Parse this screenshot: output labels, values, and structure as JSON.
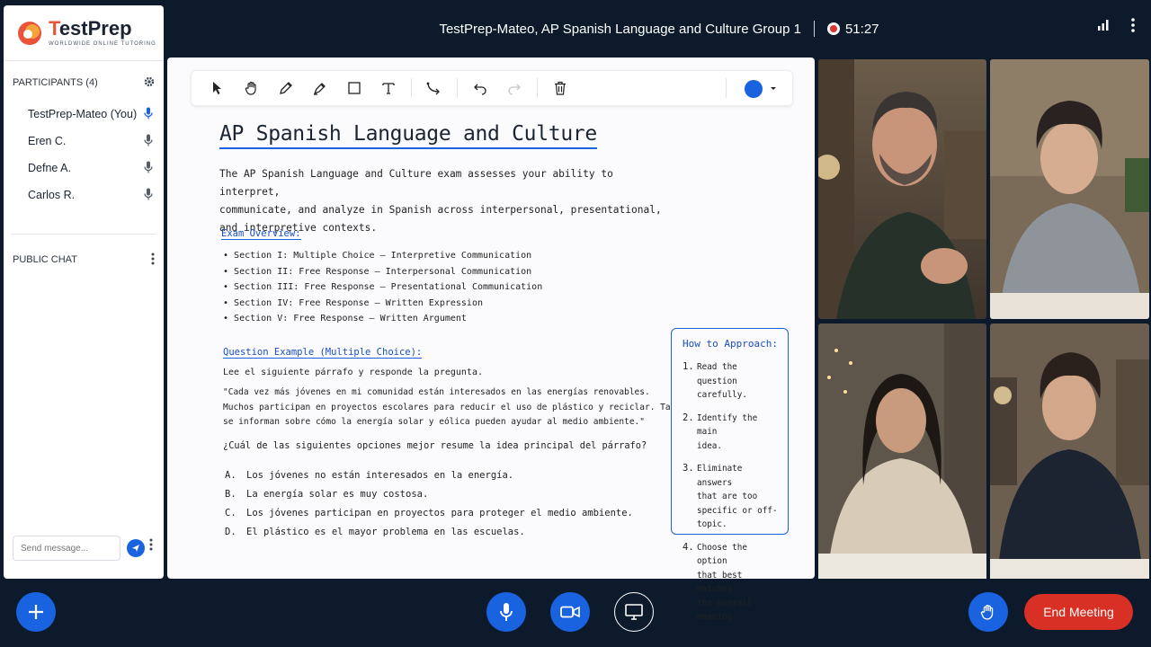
{
  "brand": {
    "name_prefix": "T",
    "name_rest": "estPrep",
    "tagline": "WORLDWIDE ONLINE TUTORING"
  },
  "header": {
    "meeting_title": "TestPrep-Mateo, AP Spanish Language and Culture Group 1",
    "timer": "51:27"
  },
  "participants": {
    "heading": "PARTICIPANTS (4)",
    "list": [
      {
        "name": "TestPrep-Mateo (You)",
        "mic_active": true
      },
      {
        "name": "Eren C.",
        "mic_active": false
      },
      {
        "name": "Defne A.",
        "mic_active": false
      },
      {
        "name": "Carlos R.",
        "mic_active": false
      }
    ]
  },
  "chat": {
    "heading": "PUBLIC CHAT",
    "placeholder": "Send message..."
  },
  "whiteboard": {
    "toolbar": {
      "tools": [
        "select-icon",
        "hand-icon",
        "pencil-icon",
        "marker-icon",
        "rectangle-icon",
        "text-icon",
        "connector-icon",
        "undo-icon",
        "redo-icon",
        "trash-icon"
      ],
      "selected_color": "#1a63e0"
    },
    "title": "AP Spanish Language and Culture",
    "intro_lines": [
      "The AP Spanish Language and Culture exam assesses your ability to interpret,",
      "communicate, and analyze in Spanish across interpersonal, presentational,",
      "and interpretive contexts."
    ],
    "overview_heading": "Exam Overview:",
    "sections": [
      "Section I:  Multiple Choice – Interpretive Communication",
      "Section II:  Free Response – Interpersonal Communication",
      "Section III:  Free Response – Presentational Communication",
      "Section IV:  Free Response – Written Expression",
      "Section V:  Free Response – Written Argument"
    ],
    "question_heading": "Question Example (Multiple Choice):",
    "instruction": "Lee el siguiente párrafo y responde la pregunta.",
    "passage_lines": [
      "\"Cada vez más jóvenes en mi comunidad están interesados en las energías renovables.",
      "Muchos participan en proyectos escolares para reducir el uso de plástico y reciclar.  También",
      "se informan sobre cómo la energía solar y eólica pueden ayudar al medio ambiente.\""
    ],
    "question": "¿Cuál de las siguientes opciones mejor resume la idea principal del párrafo?",
    "options": [
      {
        "letter": "A.",
        "text": "Los jóvenes no están interesados en la energía."
      },
      {
        "letter": "B.",
        "text": "La energía solar es muy costosa."
      },
      {
        "letter": "C.",
        "text": "Los jóvenes participan en proyectos para proteger el medio ambiente."
      },
      {
        "letter": "D.",
        "text": "El plástico es el mayor problema en las escuelas."
      }
    ],
    "approach": {
      "title": "How to Approach:",
      "steps": [
        {
          "num": "1.",
          "lines": [
            "Read the question",
            "carefully."
          ]
        },
        {
          "num": "2.",
          "lines": [
            "Identify the main",
            "idea."
          ]
        },
        {
          "num": "3.",
          "lines": [
            "Eliminate answers",
            "that are too",
            "specific or off-topic."
          ]
        },
        {
          "num": "4.",
          "lines": [
            "Choose the option",
            "that best matches",
            "the overall meaning."
          ]
        }
      ]
    }
  },
  "controls": {
    "end_meeting_label": "End Meeting"
  },
  "colors": {
    "accent": "#1a63e0",
    "danger": "#d93025",
    "background": "#0d1a2b"
  }
}
